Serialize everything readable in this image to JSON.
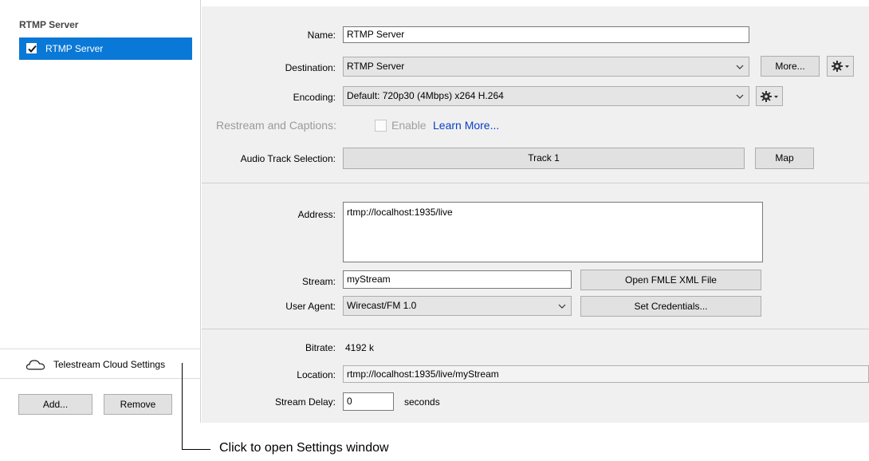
{
  "left": {
    "title": "RTMP Server",
    "destinations": [
      {
        "label": "RTMP Server",
        "checked": true
      }
    ],
    "cloud_label": "Telestream Cloud Settings",
    "add_label": "Add...",
    "remove_label": "Remove"
  },
  "form": {
    "name_label": "Name:",
    "name_value": "RTMP Server",
    "destination_label": "Destination:",
    "destination_value": "RTMP Server",
    "more_label": "More...",
    "encoding_label": "Encoding:",
    "encoding_value": "Default: 720p30 (4Mbps) x264 H.264",
    "restream_label": "Restream and Captions:",
    "enable_label": "Enable",
    "learn_more_label": "Learn More...",
    "audio_label": "Audio Track Selection:",
    "audio_value": "Track 1",
    "map_label": "Map",
    "address_label": "Address:",
    "address_value": "rtmp://localhost:1935/live",
    "stream_label": "Stream:",
    "stream_value": "myStream",
    "open_fmle_label": "Open FMLE XML File",
    "user_agent_label": "User Agent:",
    "user_agent_value": "Wirecast/FM 1.0",
    "set_credentials_label": "Set Credentials...",
    "bitrate_label": "Bitrate:",
    "bitrate_value": "4192 k",
    "location_label": "Location:",
    "location_value": "rtmp://localhost:1935/live/myStream",
    "stream_delay_label": "Stream Delay:",
    "stream_delay_value": "0",
    "seconds_label": "seconds"
  },
  "annotation": "Click to open Settings window",
  "colors": {
    "selection": "#0a78d7",
    "link": "#0a3ec7",
    "panel": "#f0f0f0"
  }
}
